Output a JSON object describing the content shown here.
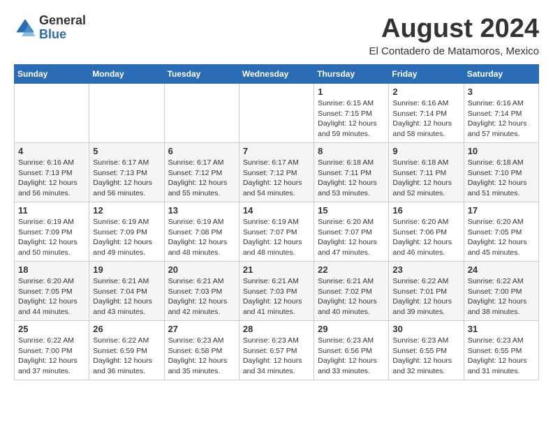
{
  "header": {
    "logo": {
      "general": "General",
      "blue": "Blue"
    },
    "title": "August 2024",
    "subtitle": "El Contadero de Matamoros, Mexico"
  },
  "weekdays": [
    "Sunday",
    "Monday",
    "Tuesday",
    "Wednesday",
    "Thursday",
    "Friday",
    "Saturday"
  ],
  "weeks": [
    [
      {
        "day": "",
        "info": ""
      },
      {
        "day": "",
        "info": ""
      },
      {
        "day": "",
        "info": ""
      },
      {
        "day": "",
        "info": ""
      },
      {
        "day": "1",
        "info": "Sunrise: 6:15 AM\nSunset: 7:15 PM\nDaylight: 12 hours\nand 59 minutes."
      },
      {
        "day": "2",
        "info": "Sunrise: 6:16 AM\nSunset: 7:14 PM\nDaylight: 12 hours\nand 58 minutes."
      },
      {
        "day": "3",
        "info": "Sunrise: 6:16 AM\nSunset: 7:14 PM\nDaylight: 12 hours\nand 57 minutes."
      }
    ],
    [
      {
        "day": "4",
        "info": "Sunrise: 6:16 AM\nSunset: 7:13 PM\nDaylight: 12 hours\nand 56 minutes."
      },
      {
        "day": "5",
        "info": "Sunrise: 6:17 AM\nSunset: 7:13 PM\nDaylight: 12 hours\nand 56 minutes."
      },
      {
        "day": "6",
        "info": "Sunrise: 6:17 AM\nSunset: 7:12 PM\nDaylight: 12 hours\nand 55 minutes."
      },
      {
        "day": "7",
        "info": "Sunrise: 6:17 AM\nSunset: 7:12 PM\nDaylight: 12 hours\nand 54 minutes."
      },
      {
        "day": "8",
        "info": "Sunrise: 6:18 AM\nSunset: 7:11 PM\nDaylight: 12 hours\nand 53 minutes."
      },
      {
        "day": "9",
        "info": "Sunrise: 6:18 AM\nSunset: 7:11 PM\nDaylight: 12 hours\nand 52 minutes."
      },
      {
        "day": "10",
        "info": "Sunrise: 6:18 AM\nSunset: 7:10 PM\nDaylight: 12 hours\nand 51 minutes."
      }
    ],
    [
      {
        "day": "11",
        "info": "Sunrise: 6:19 AM\nSunset: 7:09 PM\nDaylight: 12 hours\nand 50 minutes."
      },
      {
        "day": "12",
        "info": "Sunrise: 6:19 AM\nSunset: 7:09 PM\nDaylight: 12 hours\nand 49 minutes."
      },
      {
        "day": "13",
        "info": "Sunrise: 6:19 AM\nSunset: 7:08 PM\nDaylight: 12 hours\nand 48 minutes."
      },
      {
        "day": "14",
        "info": "Sunrise: 6:19 AM\nSunset: 7:07 PM\nDaylight: 12 hours\nand 48 minutes."
      },
      {
        "day": "15",
        "info": "Sunrise: 6:20 AM\nSunset: 7:07 PM\nDaylight: 12 hours\nand 47 minutes."
      },
      {
        "day": "16",
        "info": "Sunrise: 6:20 AM\nSunset: 7:06 PM\nDaylight: 12 hours\nand 46 minutes."
      },
      {
        "day": "17",
        "info": "Sunrise: 6:20 AM\nSunset: 7:05 PM\nDaylight: 12 hours\nand 45 minutes."
      }
    ],
    [
      {
        "day": "18",
        "info": "Sunrise: 6:20 AM\nSunset: 7:05 PM\nDaylight: 12 hours\nand 44 minutes."
      },
      {
        "day": "19",
        "info": "Sunrise: 6:21 AM\nSunset: 7:04 PM\nDaylight: 12 hours\nand 43 minutes."
      },
      {
        "day": "20",
        "info": "Sunrise: 6:21 AM\nSunset: 7:03 PM\nDaylight: 12 hours\nand 42 minutes."
      },
      {
        "day": "21",
        "info": "Sunrise: 6:21 AM\nSunset: 7:03 PM\nDaylight: 12 hours\nand 41 minutes."
      },
      {
        "day": "22",
        "info": "Sunrise: 6:21 AM\nSunset: 7:02 PM\nDaylight: 12 hours\nand 40 minutes."
      },
      {
        "day": "23",
        "info": "Sunrise: 6:22 AM\nSunset: 7:01 PM\nDaylight: 12 hours\nand 39 minutes."
      },
      {
        "day": "24",
        "info": "Sunrise: 6:22 AM\nSunset: 7:00 PM\nDaylight: 12 hours\nand 38 minutes."
      }
    ],
    [
      {
        "day": "25",
        "info": "Sunrise: 6:22 AM\nSunset: 7:00 PM\nDaylight: 12 hours\nand 37 minutes."
      },
      {
        "day": "26",
        "info": "Sunrise: 6:22 AM\nSunset: 6:59 PM\nDaylight: 12 hours\nand 36 minutes."
      },
      {
        "day": "27",
        "info": "Sunrise: 6:23 AM\nSunset: 6:58 PM\nDaylight: 12 hours\nand 35 minutes."
      },
      {
        "day": "28",
        "info": "Sunrise: 6:23 AM\nSunset: 6:57 PM\nDaylight: 12 hours\nand 34 minutes."
      },
      {
        "day": "29",
        "info": "Sunrise: 6:23 AM\nSunset: 6:56 PM\nDaylight: 12 hours\nand 33 minutes."
      },
      {
        "day": "30",
        "info": "Sunrise: 6:23 AM\nSunset: 6:55 PM\nDaylight: 12 hours\nand 32 minutes."
      },
      {
        "day": "31",
        "info": "Sunrise: 6:23 AM\nSunset: 6:55 PM\nDaylight: 12 hours\nand 31 minutes."
      }
    ]
  ]
}
